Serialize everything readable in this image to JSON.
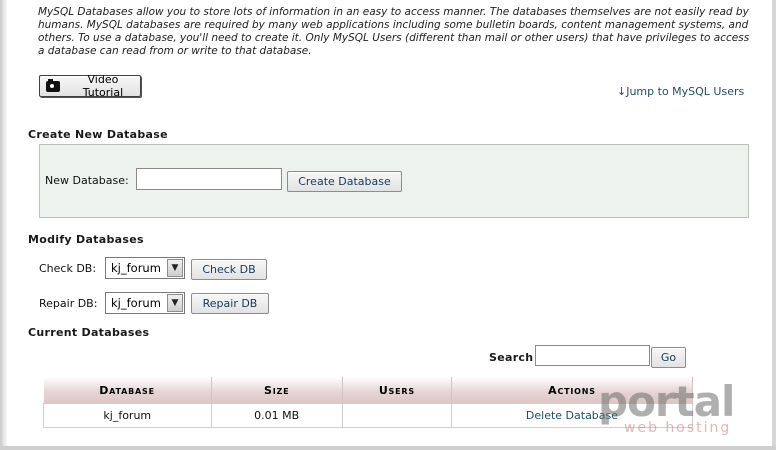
{
  "intro": "MySQL Databases allow you to store lots of information in an easy to access manner. The databases themselves are not easily read by humans. MySQL databases are required by many web applications including some bulletin boards, content management systems, and others. To use a database, you'll need to create it. Only MySQL Users (different than mail or other users) that have privileges to access a database can read from or write to that database.",
  "video_button": "Video Tutorial",
  "jump_link": "↓Jump to MySQL Users",
  "create": {
    "heading": "Create New Database",
    "label": "New Database:",
    "value": "",
    "button": "Create Database"
  },
  "modify": {
    "heading": "Modify Databases",
    "check_label": "Check DB:",
    "check_value": "kj_forum",
    "check_button": "Check DB",
    "repair_label": "Repair DB:",
    "repair_value": "kj_forum",
    "repair_button": "Repair DB"
  },
  "current": {
    "heading": "Current Databases",
    "search_label": "Search",
    "search_value": "",
    "go_button": "Go",
    "columns": [
      "Database",
      "Size",
      "Users",
      "Actions"
    ],
    "rows": [
      {
        "database": "kj_forum",
        "size": "0.01 MB",
        "users": "",
        "action": "Delete Database"
      }
    ]
  },
  "icons": {
    "video": "camera-icon",
    "select_arrow": "chevron-down-icon"
  },
  "watermark": {
    "main": "portal",
    "sub": "web hosting"
  }
}
